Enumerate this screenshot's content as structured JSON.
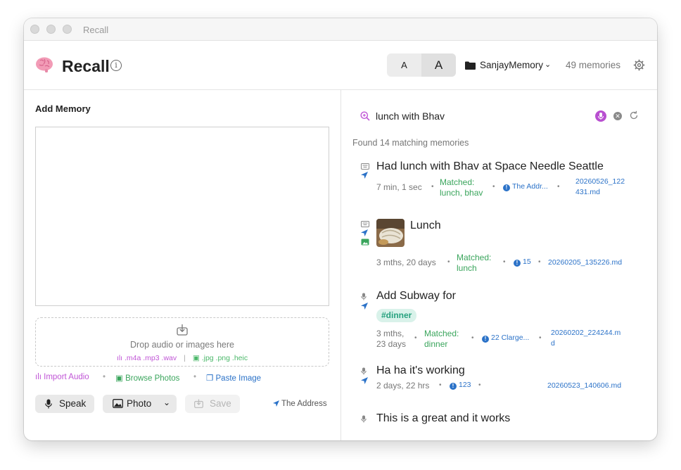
{
  "window": {
    "title": "Recall"
  },
  "header": {
    "app_title": "Recall",
    "info_icon": "info-icon",
    "font_small_label": "A",
    "font_large_label": "A",
    "folder_name": "SanjayMemory",
    "memory_count": "49 memories"
  },
  "add_memory": {
    "title": "Add Memory",
    "text_value": "",
    "drop_text": "Drop audio or images here",
    "audio_formats": ".m4a .mp3 .wav",
    "image_formats": ".jpg .png .heic",
    "format_separator": "|",
    "import_audio": "Import Audio",
    "browse_photos": "Browse Photos",
    "paste_image": "Paste Image",
    "action_separator": "•",
    "speak_label": "Speak",
    "photo_label": "Photo",
    "save_label": "Save",
    "address_label": "The Address"
  },
  "search": {
    "query": "lunch with Bhav",
    "found_text": "Found 14 matching memories"
  },
  "results": [
    {
      "title": "Had lunch with Bhav at Space Needle Seattle",
      "age": "7 min, 1 sec",
      "matched_line1": "Matched:",
      "matched_line2": "lunch, bhav",
      "location": "The Addr...",
      "file_line1": "20260526_122",
      "file_line2": "431.md"
    },
    {
      "title": "Lunch",
      "age": "3 mths, 20 days",
      "matched_line1": "Matched:",
      "matched_line2": "lunch",
      "location": "15",
      "file_line1": "20260205_135226.md"
    },
    {
      "title": "Add Subway for",
      "tag": "#dinner",
      "age_line1": "3 mths,",
      "age_line2": "23 days",
      "matched_line1": "Matched:",
      "matched_line2": "dinner",
      "location": "22 Clarge...",
      "file_line1": "20260202_224244.m",
      "file_line2": "d"
    },
    {
      "title": "Ha ha it's working",
      "age": "2 days, 22 hrs",
      "location": "123",
      "file_line1": "20260523_140606.md"
    },
    {
      "title": "This is a great and it works"
    }
  ],
  "dot": "•",
  "colors": {
    "accent_blue": "#2b72c8",
    "matched_green": "#3aa55c",
    "audio_purple": "#c055d6",
    "tag_bg": "#d9f2ea",
    "tag_text": "#26a17e"
  }
}
